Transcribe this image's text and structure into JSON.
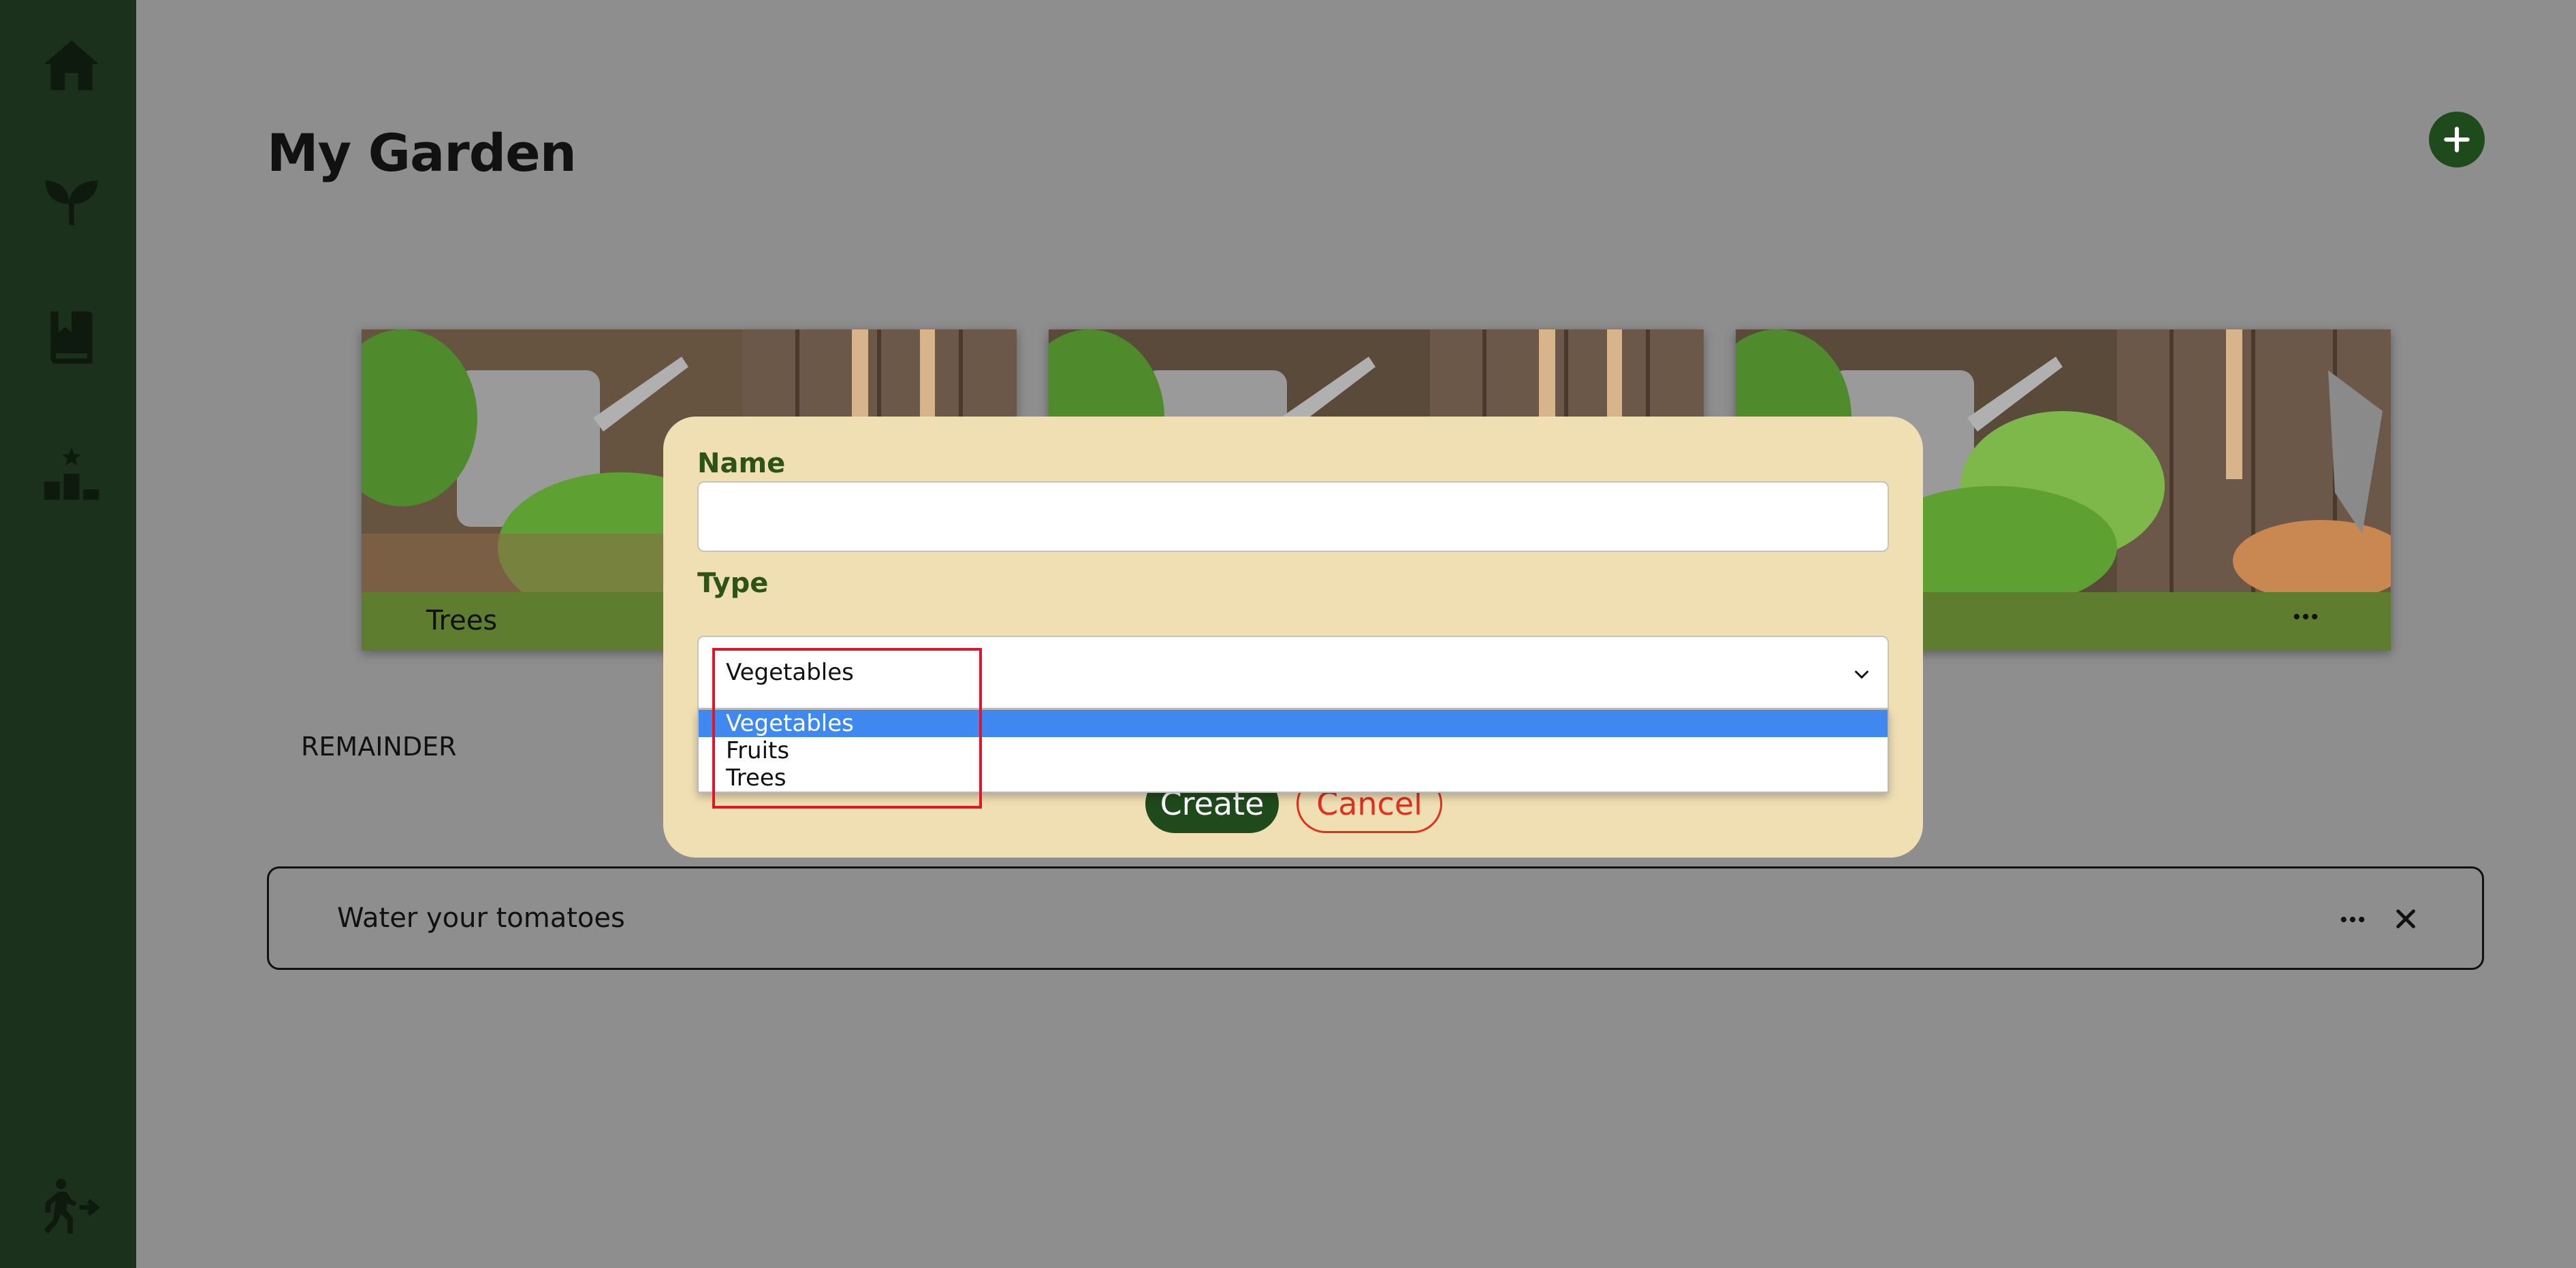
{
  "page": {
    "title": "My Garden",
    "section_label": "REMAINDER"
  },
  "sidebar": {
    "items": [
      {
        "name": "home",
        "icon": "home-icon"
      },
      {
        "name": "plants",
        "icon": "sprout-icon"
      },
      {
        "name": "journal",
        "icon": "book-icon"
      },
      {
        "name": "leaderboard",
        "icon": "podium-icon"
      }
    ],
    "logout_icon": "logout-icon"
  },
  "toolbar": {
    "add_icon": "plus-icon"
  },
  "gardens": [
    {
      "label": "Trees"
    },
    {
      "label": ""
    },
    {
      "label": ""
    }
  ],
  "reminders": [
    {
      "text": "Water your tomatoes"
    }
  ],
  "modal": {
    "name_label": "Name",
    "name_value": "",
    "type_label": "Type",
    "type_selected": "Vegetables",
    "type_options": [
      "Vegetables",
      "Fruits",
      "Trees"
    ],
    "create_label": "Create",
    "cancel_label": "Cancel"
  },
  "colors": {
    "sidebar": "#1b311b",
    "accent_green": "#1f4b1c",
    "card_footer": "#5e7d2f",
    "modal_bg": "#f1dfb4",
    "cancel_red": "#e0301e",
    "highlight": "#3e88ef"
  }
}
